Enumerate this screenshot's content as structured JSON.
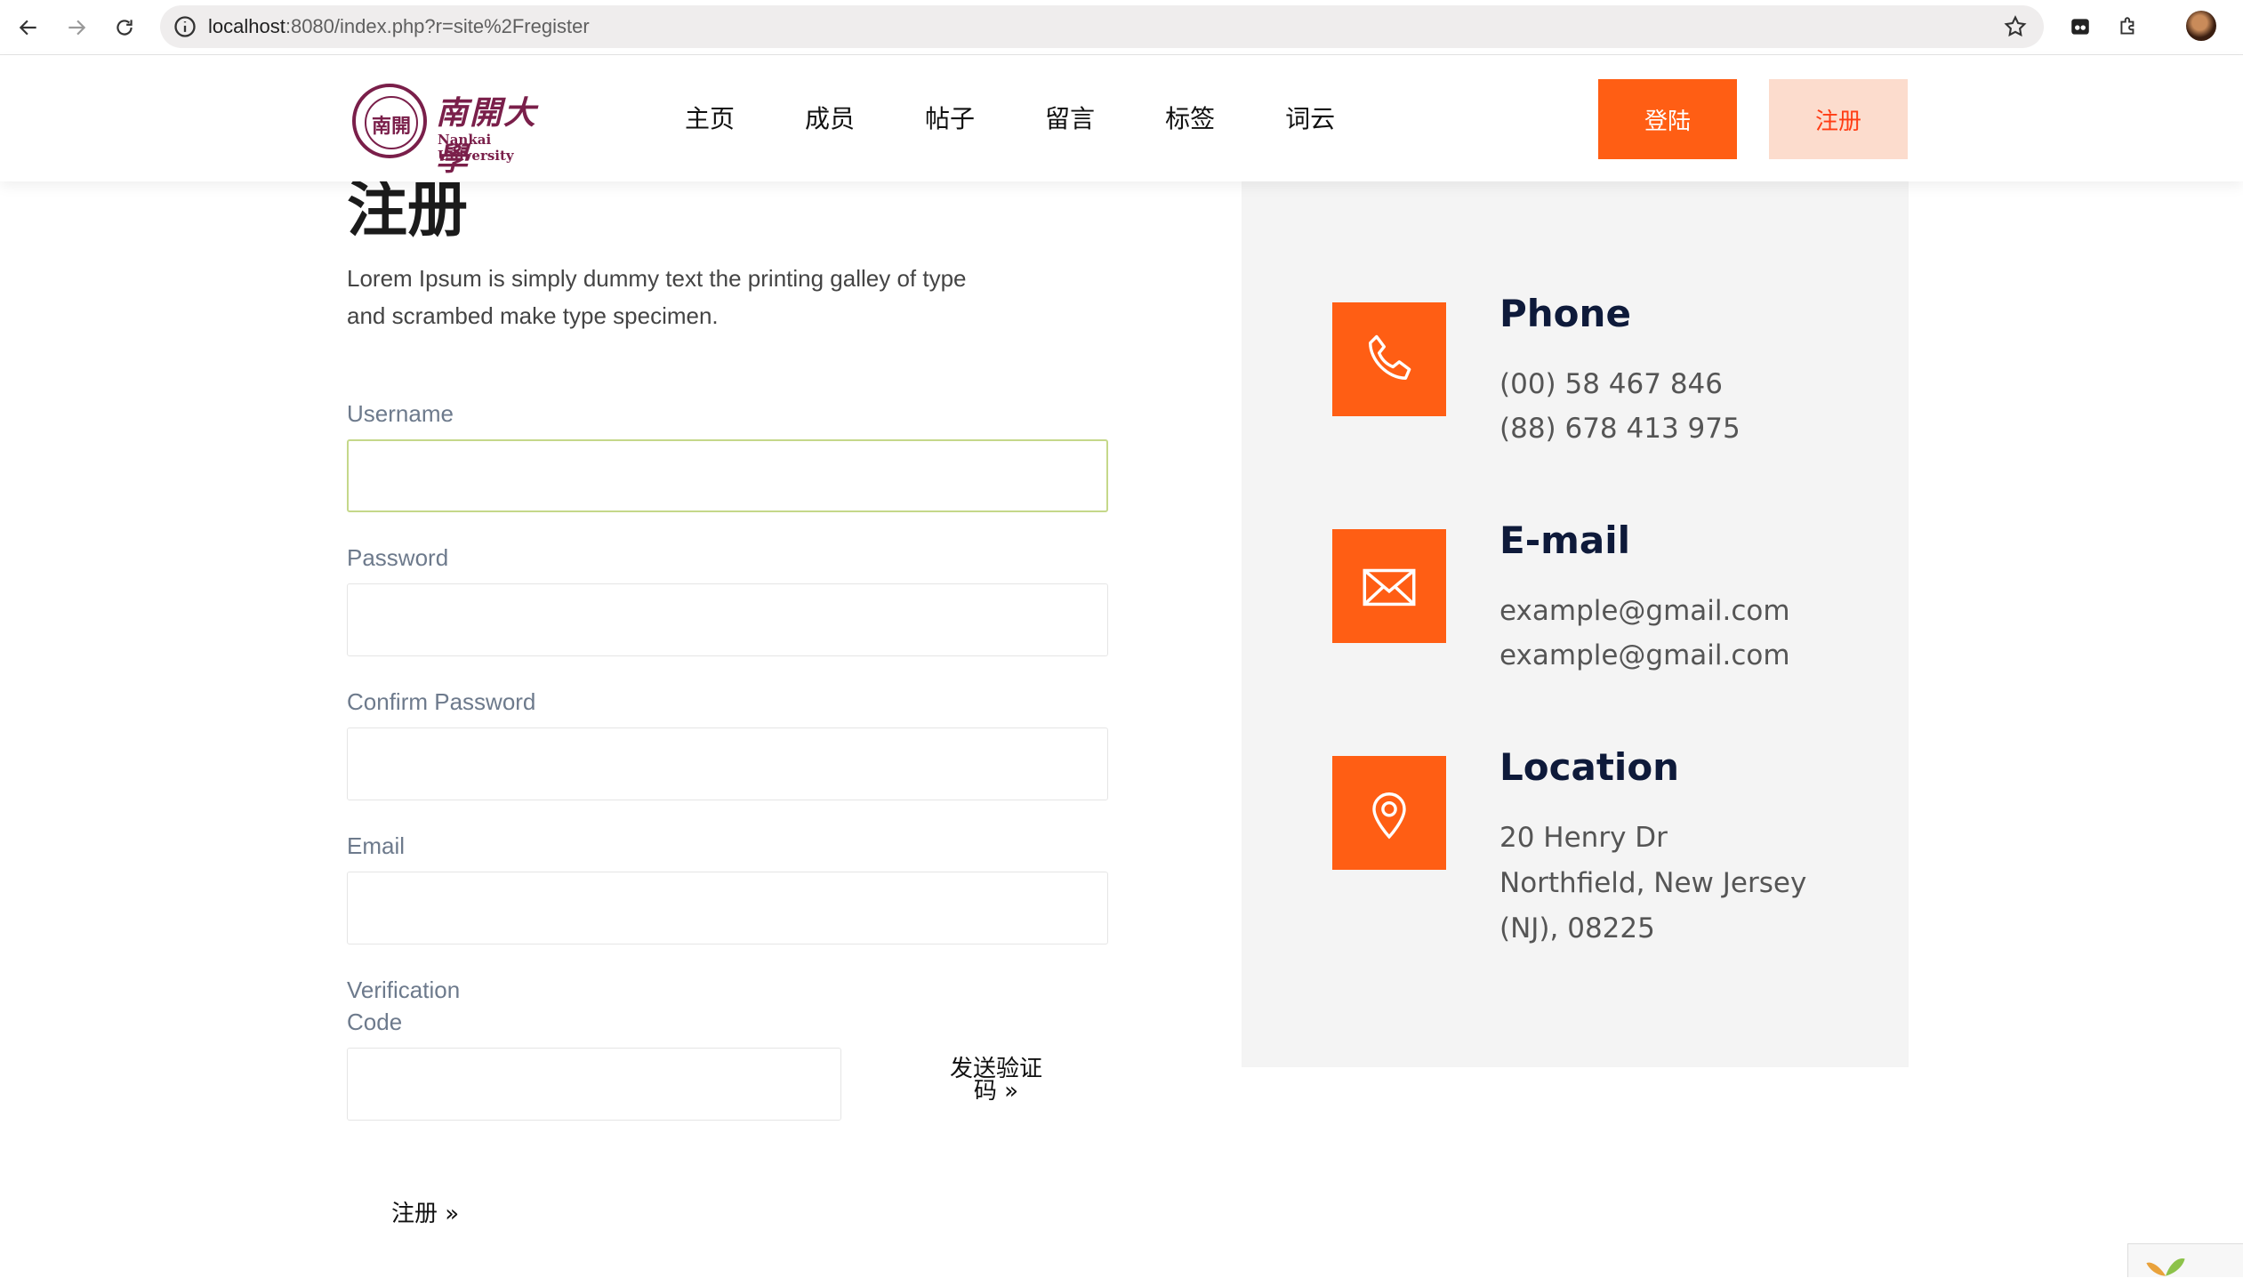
{
  "browser": {
    "url_host": "localhost",
    "url_path": ":8080/index.php?r=site%2Fregister"
  },
  "header": {
    "logo_cn": "南開大學",
    "logo_en": "Nankai University",
    "logo_seal": "南開",
    "nav": [
      "主页",
      "成员",
      "帖子",
      "留言",
      "标签",
      "词云"
    ],
    "login_label": "登陆",
    "register_label": "注册"
  },
  "form": {
    "title": "注册",
    "intro": "Lorem Ipsum is simply dummy text the printing galley of type and scrambed make type specimen.",
    "username_label": "Username",
    "password_label": "Password",
    "confirm_label": "Confirm Password",
    "email_label": "Email",
    "code_label_1": "Verification",
    "code_label_2": "Code",
    "send_code_1": "发送验证",
    "send_code_2": "码 »",
    "submit_label": "注册 »"
  },
  "contact": {
    "phone_title": "Phone",
    "phone_1": "(00) 58 467 846",
    "phone_2": "(88) 678 413 975",
    "email_title": "E-mail",
    "email_1": "example@gmail.com",
    "email_2": "example@gmail.com",
    "location_title": "Location",
    "location_1": "20 Henry Dr",
    "location_2": "Northfield, New Jersey",
    "location_3": "(NJ), 08225"
  },
  "colors": {
    "accent": "#ff5e14",
    "accent_light": "#fcdccd",
    "brand": "#7a1f4a"
  }
}
